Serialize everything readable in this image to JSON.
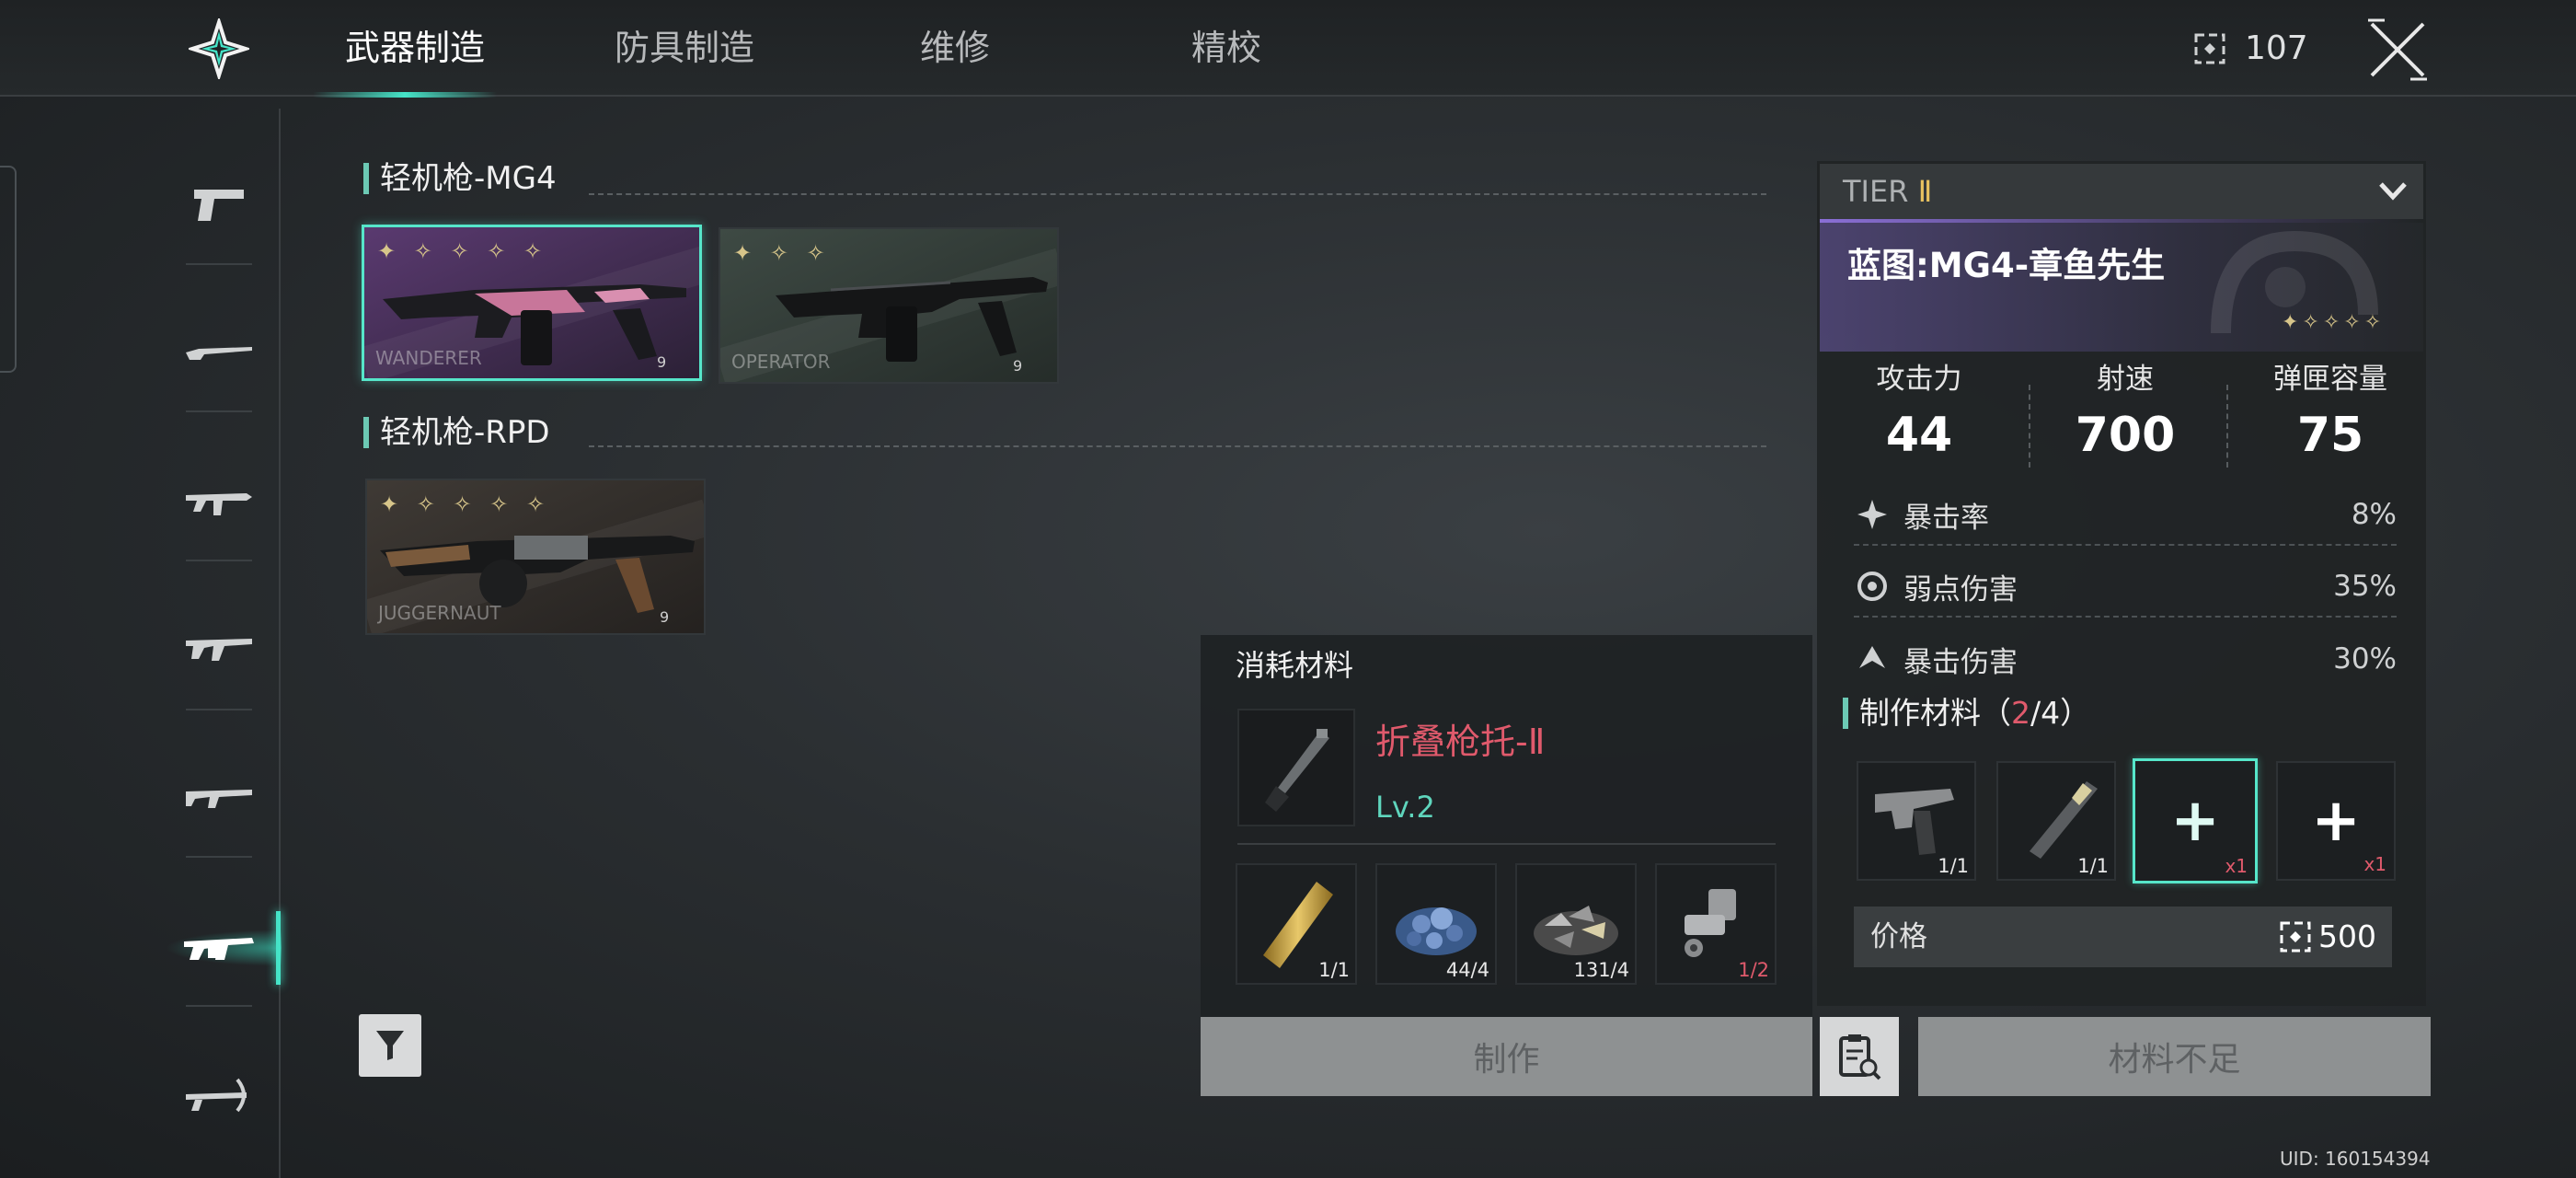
{
  "topbar": {
    "tabs": [
      {
        "label": "武器制造",
        "active": true
      },
      {
        "label": "防具制造",
        "active": false
      },
      {
        "label": "维修",
        "active": false
      },
      {
        "label": "精校",
        "active": false
      }
    ],
    "currency_icon": "currency-icon",
    "currency_amount": "107",
    "close_icon": "close-icon",
    "accent_color": "#45e4c8"
  },
  "sidebar": {
    "items": [
      {
        "icon": "pistol-icon"
      },
      {
        "icon": "sniper-rifle-icon"
      },
      {
        "icon": "smg-icon"
      },
      {
        "icon": "assault-rifle-icon"
      },
      {
        "icon": "marksman-rifle-icon"
      },
      {
        "icon": "light-machine-gun-icon",
        "active": true
      },
      {
        "icon": "crossbow-icon"
      }
    ]
  },
  "groups": [
    {
      "title": "轻机枪-MG4",
      "cards": [
        {
          "tag": "WANDERER",
          "stars": "✦ ✧ ✧ ✧ ✧",
          "num": "9",
          "selected": true
        },
        {
          "tag": "OPERATOR",
          "stars": "✦ ✧ ✧",
          "num": "9",
          "selected": false
        }
      ]
    },
    {
      "title": "轻机枪-RPD",
      "cards": [
        {
          "tag": "JUGGERNAUT",
          "stars": "✦ ✧ ✧ ✧ ✧",
          "num": "9",
          "selected": false
        }
      ]
    }
  ],
  "filter_icon": "filter-icon",
  "consumables": {
    "title": "消耗材料",
    "part_name": "折叠枪托-Ⅱ",
    "part_level": "Lv.2",
    "materials": [
      {
        "icon": "brass-rod-icon",
        "count": "1/1",
        "short": false
      },
      {
        "icon": "blue-crystal-pile-icon",
        "count": "44/4",
        "short": false
      },
      {
        "icon": "metal-scrap-pile-icon",
        "count": "131/4",
        "short": false
      },
      {
        "icon": "bolt-part-icon",
        "count": "1/2",
        "short": true
      }
    ]
  },
  "stats": {
    "tier_prefix": "TIER",
    "tier_num": "Ⅱ",
    "blueprint_name": "蓝图:MG4-章鱼先生",
    "blueprint_stars": "✦✧✧✧✧",
    "main": [
      {
        "label": "攻击力",
        "value": "44"
      },
      {
        "label": "射速",
        "value": "700"
      },
      {
        "label": "弹匣容量",
        "value": "75"
      }
    ],
    "sub": [
      {
        "icon": "crit-rate-icon",
        "label": "暴击率",
        "value": "8%"
      },
      {
        "icon": "weakpoint-icon",
        "label": "弱点伤害",
        "value": "35%"
      },
      {
        "icon": "crit-damage-icon",
        "label": "暴击伤害",
        "value": "30%"
      }
    ],
    "craft_title": "制作材料（",
    "craft_have": "2",
    "craft_total": "/4）",
    "slots": [
      {
        "type": "item",
        "icon": "gun-receiver-icon",
        "count": "1/1"
      },
      {
        "type": "item",
        "icon": "gun-barrel-icon",
        "count": "1/1"
      },
      {
        "type": "add",
        "req": "x1",
        "highlight": true
      },
      {
        "type": "add",
        "req": "x1",
        "highlight": false
      }
    ],
    "price_label": "价格",
    "price_value": "500"
  },
  "buttons": {
    "craft": "制作",
    "recipe_icon": "recipe-search-icon",
    "insufficient": "材料不足"
  },
  "uid": "UID: 160154394"
}
